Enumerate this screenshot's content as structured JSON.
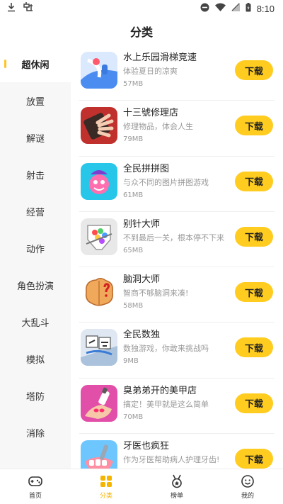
{
  "status_bar": {
    "time": "8:10",
    "left_icons": [
      "download-icon",
      "game-controller-icon"
    ],
    "right_icons": [
      "dnd-icon",
      "wifi-icon",
      "signal-icon",
      "battery-icon"
    ]
  },
  "header": {
    "title": "分类"
  },
  "sidebar": {
    "items": [
      {
        "label": "超休闲",
        "active": true
      },
      {
        "label": "放置"
      },
      {
        "label": "解谜"
      },
      {
        "label": "射击"
      },
      {
        "label": "经营"
      },
      {
        "label": "动作"
      },
      {
        "label": "角色扮演"
      },
      {
        "label": "大乱斗"
      },
      {
        "label": "模拟"
      },
      {
        "label": "塔防"
      },
      {
        "label": "消除"
      }
    ]
  },
  "games": [
    {
      "title": "水上乐园滑梯竞速",
      "desc": "体验夏日的凉爽",
      "size": "57MB",
      "button": "下载",
      "icon": "water-slide-icon"
    },
    {
      "title": "十三號修理店",
      "desc": "修理物品，体会人生",
      "size": "79MB",
      "button": "下载",
      "icon": "repair-shop-icon"
    },
    {
      "title": "全民拼拼图",
      "desc": "与众不同的图片拼图游戏",
      "size": "61MB",
      "button": "下载",
      "icon": "jigsaw-puzzle-icon"
    },
    {
      "title": "别针大师",
      "desc": "不到最后一关，根本停不下来",
      "size": "65MB",
      "button": "下载",
      "icon": "pin-master-icon"
    },
    {
      "title": "脑洞大师",
      "desc": "智商不够脑洞来凑!",
      "size": "58MB",
      "button": "下载",
      "icon": "brain-master-icon"
    },
    {
      "title": "全民数独",
      "desc": "数独游戏，你敢来挑战吗",
      "size": "9MB",
      "button": "下载",
      "icon": "sudoku-icon"
    },
    {
      "title": "臭弟弟开的美甲店",
      "desc": "搞定！美甲就是这么简单",
      "size": "70MB",
      "button": "下载",
      "icon": "nail-salon-icon"
    },
    {
      "title": "牙医也疯狂",
      "desc": "作为牙医帮助病人护理牙齿!",
      "size": "",
      "button": "下载",
      "icon": "crazy-dentist-icon"
    }
  ],
  "bottom_nav": [
    {
      "label": "首页",
      "icon": "gamepad-icon"
    },
    {
      "label": "分类",
      "icon": "category-grid-icon",
      "active": true
    },
    {
      "label": "榜单",
      "icon": "ranking-medal-icon"
    },
    {
      "label": "我的",
      "icon": "profile-smile-icon"
    }
  ],
  "colors": {
    "accent": "#ffcc1f",
    "active_nav": "#f5b400",
    "sidebar_bg": "#f7f7f7",
    "muted_text": "#999999"
  }
}
